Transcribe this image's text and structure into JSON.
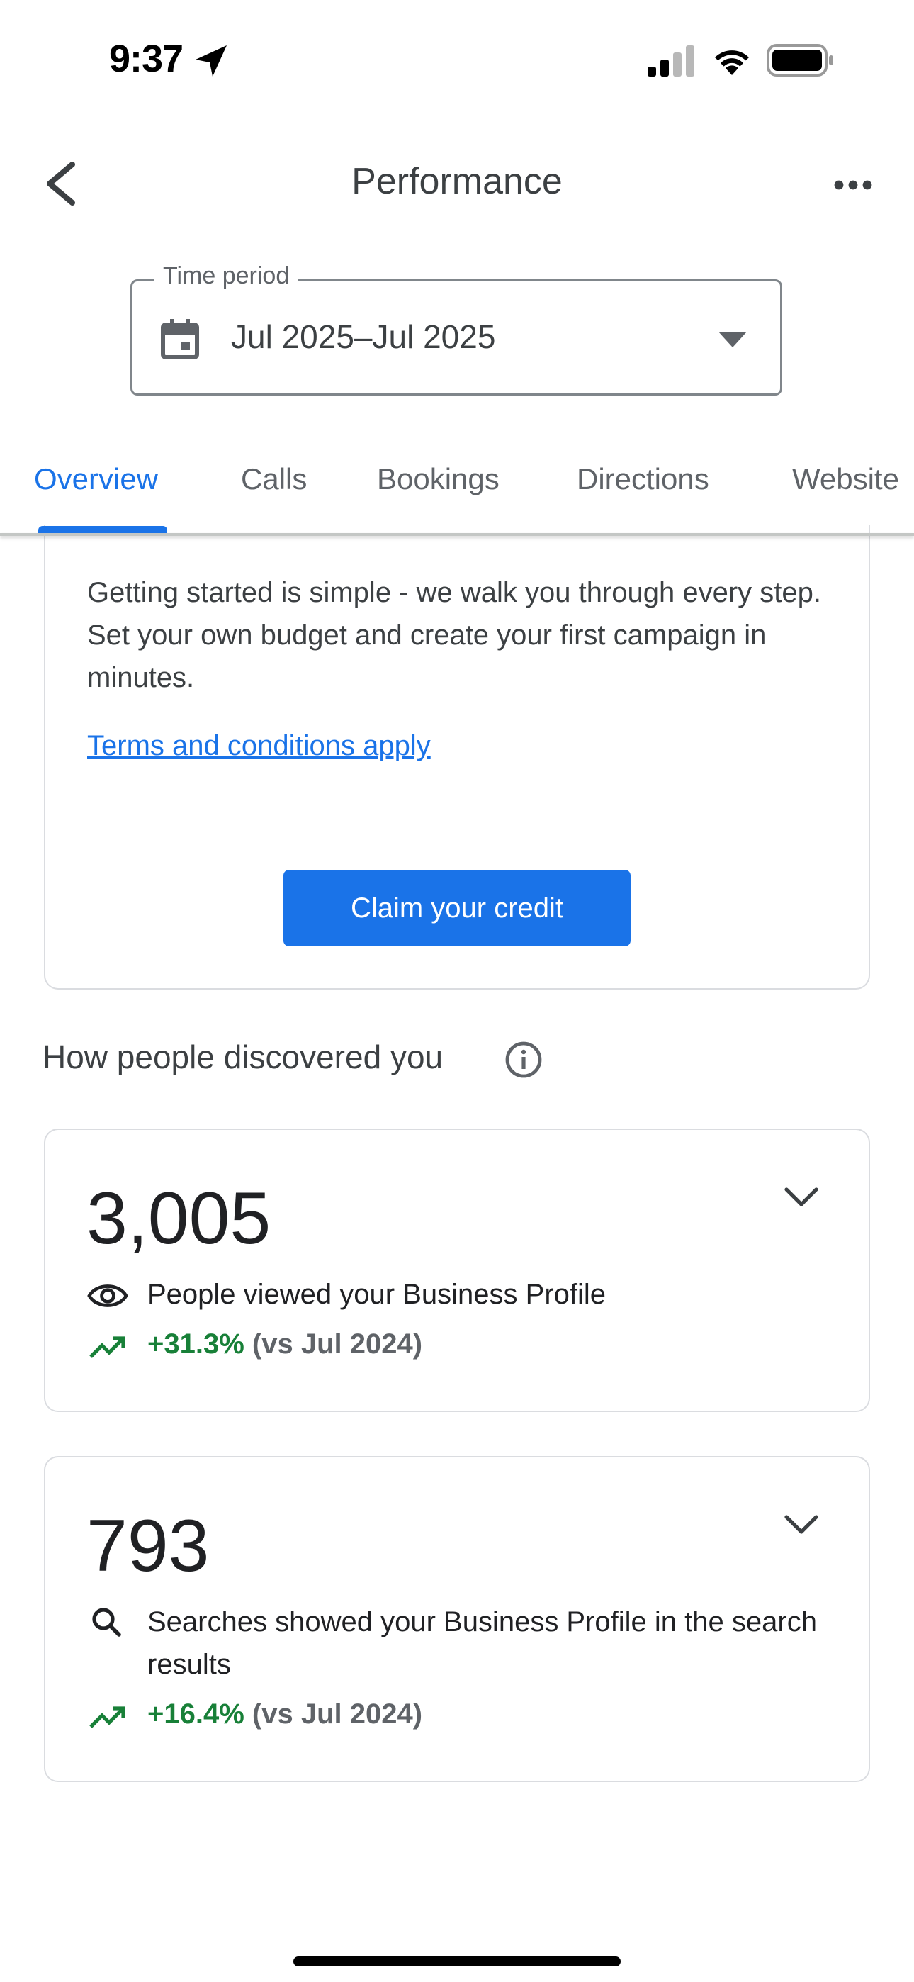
{
  "status_bar": {
    "time": "9:37"
  },
  "app_bar": {
    "title": "Performance"
  },
  "time_period": {
    "label": "Time period",
    "value": "Jul 2025–Jul 2025"
  },
  "tabs": [
    {
      "label": "Overview",
      "active": true
    },
    {
      "label": "Calls"
    },
    {
      "label": "Bookings"
    },
    {
      "label": "Directions"
    },
    {
      "label": "Website"
    }
  ],
  "promo": {
    "body": "Getting started is simple - we walk you through every step. Set your own budget and create your first campaign in minutes.",
    "terms_link": "Terms and conditions apply",
    "button": "Claim your credit"
  },
  "discovery": {
    "title": "How people discovered you",
    "metrics": [
      {
        "value": "3,005",
        "icon": "eye-icon",
        "description": "People viewed your Business Profile",
        "change": "+31.3%",
        "comparison": "(vs Jul 2024)"
      },
      {
        "value": "793",
        "icon": "search-icon",
        "description": "Searches showed your Business Profile in the search results",
        "change": "+16.4%",
        "comparison": "(vs Jul 2024)"
      }
    ]
  },
  "colors": {
    "accent": "#1a73e8",
    "positive": "#188038"
  }
}
